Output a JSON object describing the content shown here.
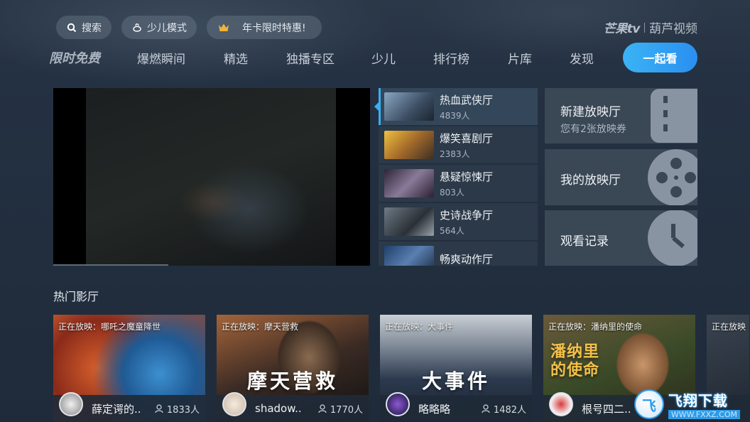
{
  "topbar": {
    "search": "搜索",
    "kids_mode": "少儿模式",
    "annual_offer": "年卡限时特惠!"
  },
  "brand": {
    "mango": "芒果tv",
    "hulu": "葫芦视频"
  },
  "nav": {
    "free": "限时免费",
    "items": [
      "爆燃瞬间",
      "精选",
      "独播专区",
      "少儿",
      "排行榜",
      "片库",
      "发现"
    ],
    "watch_together": "一起看"
  },
  "halls": [
    {
      "name": "热血武侠厅",
      "count": "4839人",
      "color": "#5a6f85"
    },
    {
      "name": "爆笑喜剧厅",
      "count": "2383人",
      "color": "#b8892f"
    },
    {
      "name": "悬疑惊悚厅",
      "count": "803人",
      "color": "#5b4d6a"
    },
    {
      "name": "史诗战争厅",
      "count": "564人",
      "color": "#4d5660"
    },
    {
      "name": "畅爽动作厅",
      "count": "",
      "color": "#2f5580"
    }
  ],
  "cards": {
    "new_hall": "新建放映厅",
    "tickets": "您有2张放映券",
    "my_hall": "我的放映厅",
    "history": "观看记录"
  },
  "hot": {
    "title": "热门影厅",
    "items": [
      {
        "now": "正在放映：哪吒之魔童降世",
        "big": "",
        "host": "薛定谔的..",
        "viewers": "1833人"
      },
      {
        "now": "正在放映：摩天营救",
        "big": "摩天营救",
        "host": "shadow..",
        "viewers": "1770人"
      },
      {
        "now": "正在放映：大事件",
        "big": "大事件",
        "host": "略略略",
        "viewers": "1482人"
      },
      {
        "now": "正在放映：潘纳里的使命",
        "big": "潘纳里的使命",
        "host": "根号四二..",
        "viewers": ""
      },
      {
        "now": "正在放映",
        "big": "",
        "host": "",
        "viewers": ""
      }
    ]
  },
  "watermark": {
    "title": "飞翔下载",
    "url": "WWW.FXXZ.COM"
  }
}
